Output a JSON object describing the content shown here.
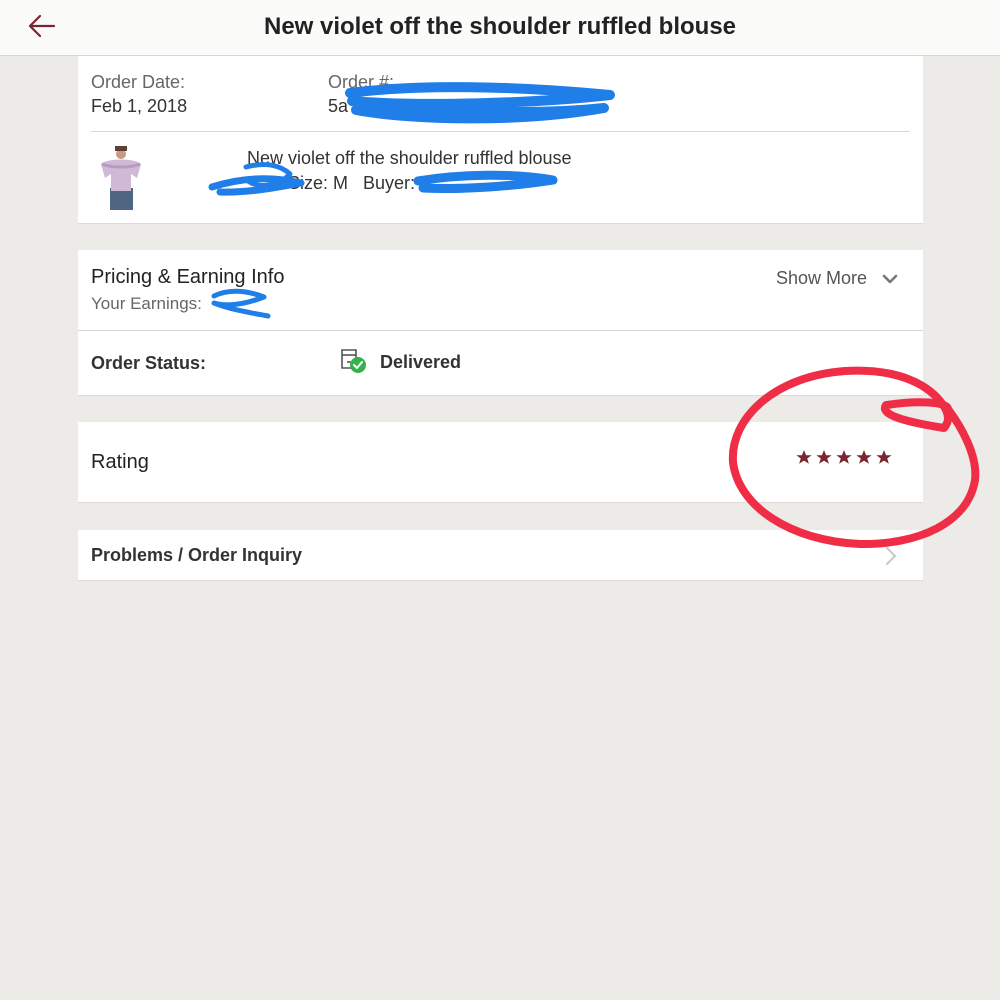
{
  "header": {
    "title": "New violet off the shoulder ruffled blouse",
    "back_label": "Back"
  },
  "order": {
    "date_label": "Order Date:",
    "date_value": "Feb 1, 2018",
    "number_label": "Order #:",
    "number_value": "5a",
    "item_title": "New violet off the shoulder ruffled blouse",
    "size_text": "Size: M",
    "buyer_label": "Buyer:"
  },
  "pricing": {
    "title": "Pricing & Earning Info",
    "earnings_label": "Your Earnings:",
    "show_more": "Show More"
  },
  "status": {
    "label": "Order Status:",
    "value": "Delivered"
  },
  "rating": {
    "label": "Rating",
    "stars": 5,
    "max": 5
  },
  "problems": {
    "label": "Problems / Order Inquiry"
  },
  "colors": {
    "accent": "#7a2430",
    "delivered_check": "#34b24c",
    "redaction": "#1f7ee8",
    "annotation": "#f02d47"
  },
  "icons": {
    "back": "arrow-left-icon",
    "chevron_down": "chevron-down-icon",
    "chevron_right": "chevron-right-icon",
    "status": "package-delivered-icon",
    "star": "star-icon"
  }
}
